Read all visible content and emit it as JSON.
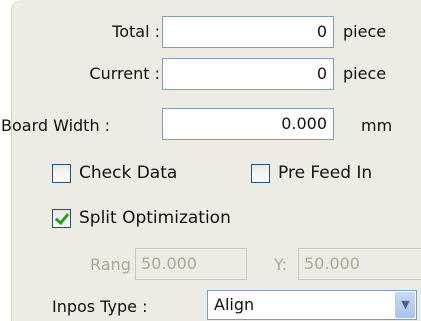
{
  "form": {
    "total": {
      "label": "Total :",
      "value": "0",
      "unit": "piece"
    },
    "current": {
      "label": "Current :",
      "value": "0",
      "unit": "piece"
    },
    "board_width": {
      "label": "Board Width :",
      "value": "0.000",
      "unit": "mm"
    },
    "check_data": {
      "label": "Check Data",
      "checked": false
    },
    "pre_feed_in": {
      "label": "Pre Feed In",
      "checked": false
    },
    "split_optimization": {
      "label": "Split Optimization",
      "checked": true
    },
    "rang": {
      "label": "Rang",
      "value": "50.000",
      "enabled": false
    },
    "y": {
      "label": "Y:",
      "value": "50.000",
      "enabled": false
    },
    "inpos_type": {
      "label": "Inpos Type :",
      "selected": "Align"
    }
  },
  "icons": {
    "dropdown": "chevron-down-icon",
    "check": "checkmark-icon"
  },
  "colors": {
    "panel_bg": "#ecebe4",
    "field_border": "#7f9db9",
    "disabled_text": "#aca899",
    "check_green": "#21a121"
  }
}
